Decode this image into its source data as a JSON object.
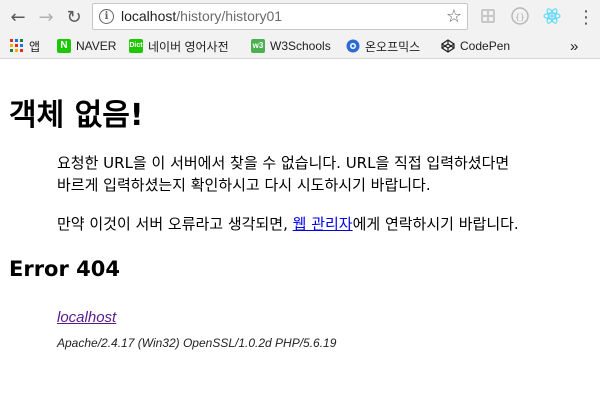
{
  "browser": {
    "url_host": "localhost",
    "url_path": "/history/history01",
    "back_glyph": "←",
    "forward_glyph": "→",
    "reload_glyph": "↻",
    "info_glyph": "i",
    "star_glyph": "☆",
    "menu_glyph": "⋮",
    "extensions": [
      "grid-extension-icon",
      "code-extension-icon",
      "react-devtools-icon"
    ]
  },
  "bookmarks": {
    "apps_label": "앱",
    "items": [
      {
        "label": "NAVER",
        "icon": "naver-icon",
        "icon_text": "N",
        "color": "#1ec800"
      },
      {
        "label": "네이버 영어사전",
        "icon": "naver-dict-icon",
        "icon_text": "Dict",
        "color": "#1ec800"
      },
      {
        "label": "W3Schools",
        "icon": "w3schools-icon",
        "icon_text": "w3",
        "color": "#4caf50"
      },
      {
        "label": "온오프믹스",
        "icon": "onoffmix-icon",
        "icon_text": "",
        "color": "#2b6cd4"
      },
      {
        "label": "CodePen",
        "icon": "codepen-icon",
        "icon_text": "",
        "color": "#222222"
      }
    ],
    "overflow_glyph": "»"
  },
  "page": {
    "title": "객체 없음!",
    "message_line1": "요청한 URL을 이 서버에서 찾을 수 없습니다. URL을 직접 입력하셨다면",
    "message_line2": "바르게 입력하셨는지 확인하시고 다시 시도하시기 바랍니다.",
    "contact_prefix": "만약 이것이 서버 오류라고 생각되면, ",
    "contact_link": "웹 관리자",
    "contact_suffix": "에게 연락하시기 바랍니다.",
    "error_heading": "Error 404",
    "server_link": "localhost",
    "server_info": "Apache/2.4.17 (Win32) OpenSSL/1.0.2d PHP/5.6.19"
  },
  "colors": {
    "link": "#0000ee",
    "visited_link": "#551a8b"
  }
}
